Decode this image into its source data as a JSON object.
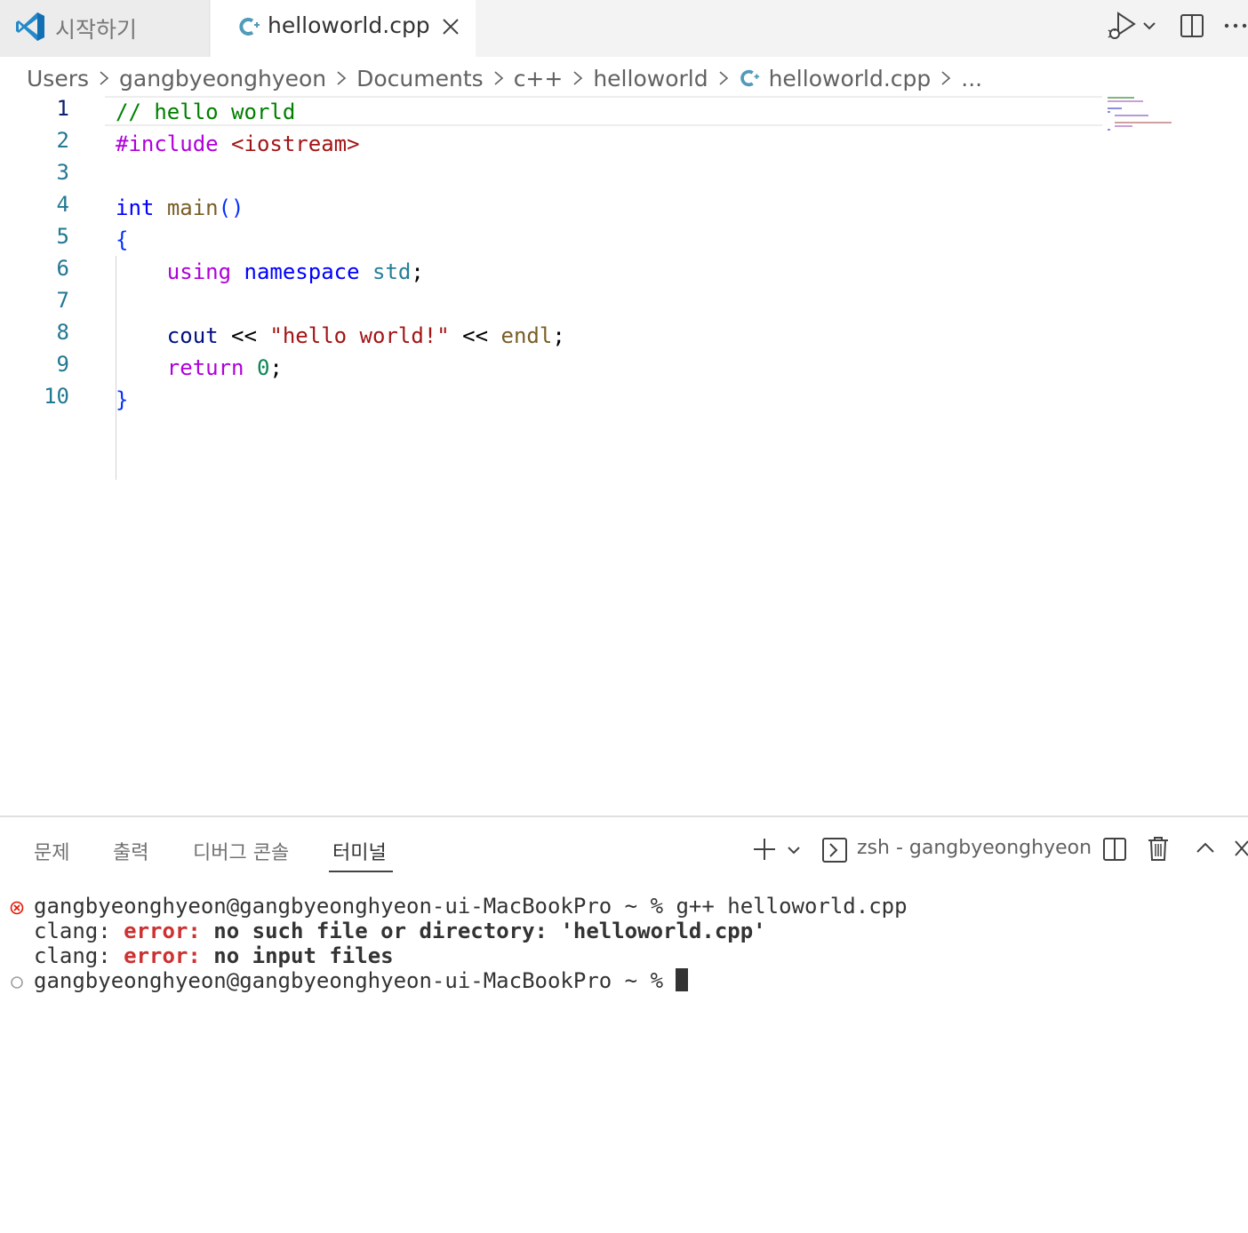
{
  "tabs": [
    {
      "label": "시작하기",
      "active": false
    },
    {
      "label": "helloworld.cpp",
      "active": true
    }
  ],
  "breadcrumb": {
    "segments": [
      "Users",
      "gangbyeonghyeon",
      "Documents",
      "c++",
      "helloworld",
      "helloworld.cpp"
    ],
    "ellipsis": "..."
  },
  "editor": {
    "line_numbers": [
      "1",
      "2",
      "3",
      "4",
      "5",
      "6",
      "7",
      "8",
      "9",
      "10"
    ],
    "lines": {
      "l1": {
        "comment": "// hello world"
      },
      "l2": {
        "directive": "#include",
        "header": "<iostream>"
      },
      "l4": {
        "type": "int",
        "fn": "main",
        "parens": "()"
      },
      "l5": {
        "brace": "{"
      },
      "l6": {
        "using": "using",
        "namespace": "namespace",
        "std": "std",
        "semi": ";"
      },
      "l8": {
        "cout": "cout",
        "op1": "<<",
        "str": "\"hello world!\"",
        "op2": "<<",
        "endl": "endl",
        "semi": ";"
      },
      "l9": {
        "ret": "return",
        "num": "0",
        "semi": ";"
      },
      "l10": {
        "brace": "}"
      }
    }
  },
  "panel": {
    "tabs": [
      "문제",
      "출력",
      "디버그 콘솔",
      "터미널"
    ],
    "active_tab": "터미널",
    "terminal_name": "zsh - gangbyeonghyeon"
  },
  "terminal": {
    "line1": {
      "prompt": "gangbyeonghyeon@gangbyeonghyeon-ui-MacBookPro ~ % ",
      "command": "g++ helloworld.cpp",
      "status": "error"
    },
    "line2": {
      "prefix": "clang: ",
      "err": "error:",
      "msg": " no such file or directory: 'helloworld.cpp'"
    },
    "line3": {
      "prefix": "clang: ",
      "err": "error:",
      "msg": " no input files"
    },
    "line4": {
      "prompt": "gangbyeonghyeon@gangbyeonghyeon-ui-MacBookPro ~ % ",
      "status": "idle"
    }
  },
  "colors": {
    "accent": "#007acc",
    "error": "#cd3131",
    "line_number": "#237893"
  },
  "icons": [
    "vscode-logo-icon",
    "cpp-file-icon",
    "close-icon",
    "run-debug-icon",
    "chevron-down-icon",
    "split-editor-icon",
    "more-actions-icon",
    "chevron-right-icon",
    "plus-icon",
    "terminal-icon",
    "trash-icon",
    "chevron-up-icon"
  ]
}
